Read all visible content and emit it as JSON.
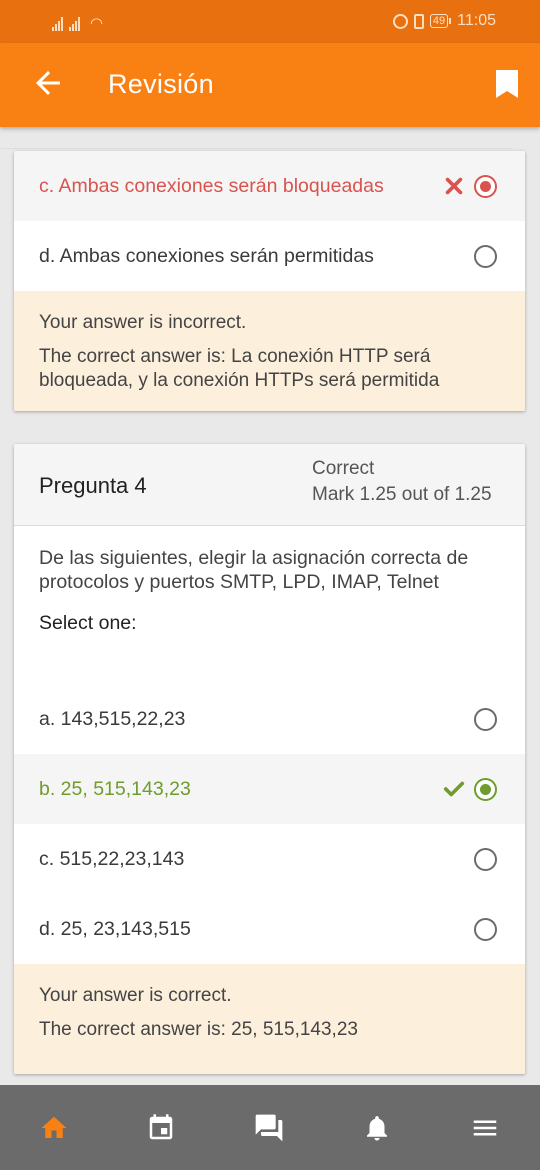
{
  "status_bar": {
    "time": "11:05",
    "battery": "49"
  },
  "app_bar": {
    "title": "Revisión",
    "back_icon": "arrow-left-icon",
    "bookmark_icon": "bookmark-icon"
  },
  "question3": {
    "options": [
      {
        "label": "c. Ambas conexiones serán bloqueadas",
        "selected": true,
        "status": "incorrect"
      },
      {
        "label": "d. Ambas conexiones serán permitidas",
        "selected": false,
        "status": ""
      }
    ],
    "feedback": {
      "result": "Your answer is incorrect.",
      "correct_answer": "The correct answer is: La conexión HTTP será bloqueada, y la conexión HTTPs será permitida"
    }
  },
  "question4": {
    "title": "Pregunta 4",
    "state": "Correct",
    "mark": "Mark 1.25 out of 1.25",
    "text": "De las siguientes, elegir la asignación correcta de protocolos y puertos SMTP, LPD, IMAP, Telnet",
    "prompt": "Select one:",
    "options": [
      {
        "label": "a. 143,515,22,23",
        "selected": false,
        "status": ""
      },
      {
        "label": "b. 25, 515,143,23",
        "selected": true,
        "status": "correct"
      },
      {
        "label": "c. 515,22,23,143",
        "selected": false,
        "status": ""
      },
      {
        "label": "d. 25, 23,143,515",
        "selected": false,
        "status": ""
      }
    ],
    "feedback": {
      "result": "Your answer is correct.",
      "correct_answer": "The correct answer is: 25, 515,143,23"
    }
  },
  "bottom_nav": [
    "home-icon",
    "calendar-icon",
    "messages-icon",
    "notifications-icon",
    "menu-icon"
  ],
  "colors": {
    "status_bar": "#e8700e",
    "app_bar": "#f98012",
    "incorrect": "#d9534f",
    "correct": "#6f9c2c",
    "feedback_bg": "#fcefdc",
    "nav_bg": "#6b6b6b",
    "nav_active": "#f98012"
  }
}
